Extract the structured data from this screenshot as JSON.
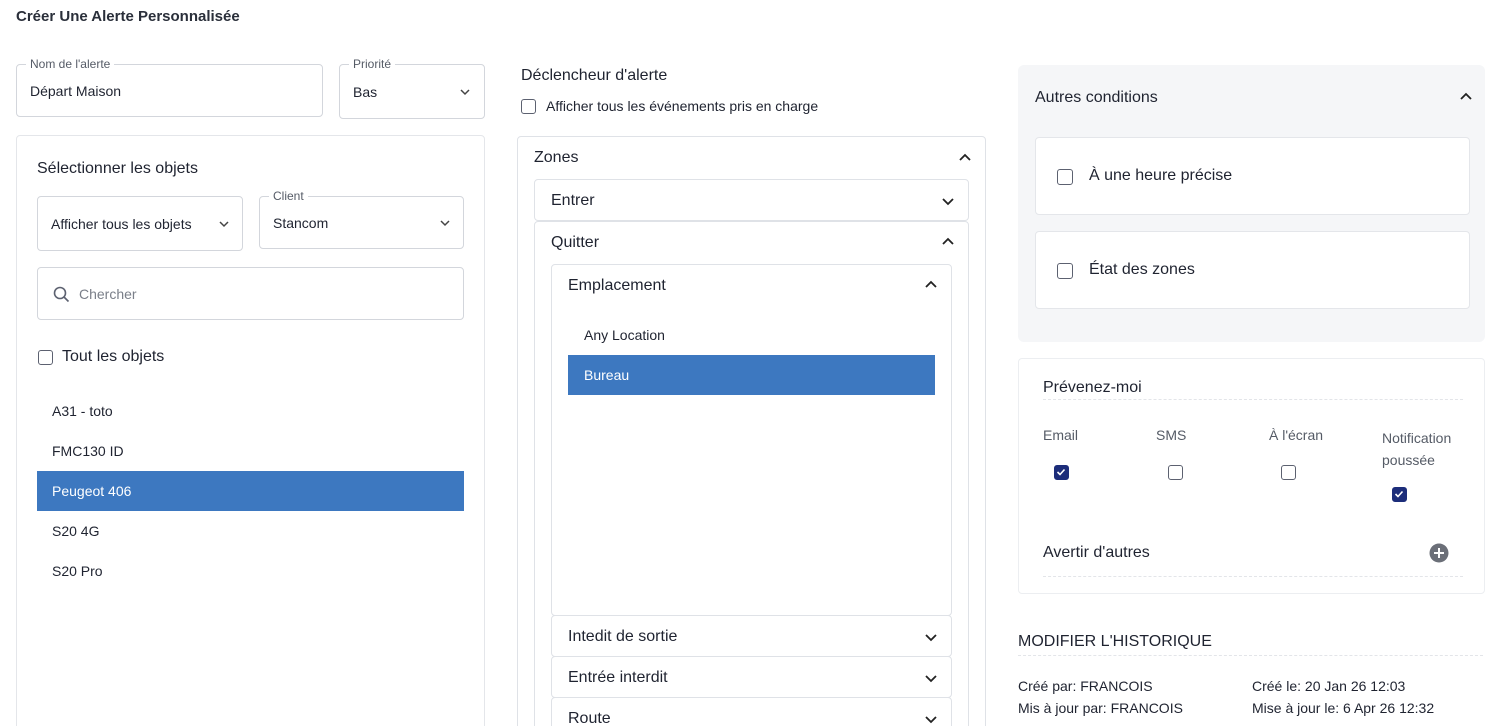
{
  "page": {
    "title": "Créer Une Alerte Personnalisée"
  },
  "alert_name": {
    "label": "Nom de l'alerte",
    "value": "Départ Maison"
  },
  "priority": {
    "label": "Priorité",
    "value": "Bas"
  },
  "objects_panel": {
    "title": "Sélectionner les objets",
    "filter_value": "Afficher tous les objets",
    "client_label": "Client",
    "client_value": "Stancom",
    "search_placeholder": "Chercher",
    "all_objects_label": "Tout les objets",
    "items": [
      {
        "label": "A31 - toto",
        "selected": false
      },
      {
        "label": "FMC130 ID",
        "selected": false
      },
      {
        "label": "Peugeot 406",
        "selected": true
      },
      {
        "label": "S20 4G",
        "selected": false
      },
      {
        "label": "S20 Pro",
        "selected": false
      }
    ]
  },
  "trigger": {
    "title": "Déclencheur d'alerte",
    "show_all_label": "Afficher tous les événements pris en charge",
    "zones_label": "Zones",
    "enter_label": "Entrer",
    "leave_label": "Quitter",
    "location_label": "Emplacement",
    "locations": [
      {
        "label": "Any Location",
        "selected": false
      },
      {
        "label": "Bureau",
        "selected": true
      }
    ],
    "exit_forbidden_label": "Intedit de sortie",
    "entry_forbidden_label": "Entrée interdit",
    "route_label": "Route"
  },
  "other_conditions": {
    "title": "Autres conditions",
    "specific_time_label": "À une heure précise",
    "zone_state_label": "État des zones"
  },
  "notify": {
    "title": "Prévenez-moi",
    "channels": [
      {
        "label": "Email",
        "checked": true
      },
      {
        "label": "SMS",
        "checked": false
      },
      {
        "label": "À l'écran",
        "checked": false
      },
      {
        "label": "Notification poussée",
        "checked": true
      }
    ],
    "notify_others_label": "Avertir d'autres"
  },
  "history": {
    "title": "MODIFIER L'HISTORIQUE",
    "created_by": "Créé par: FRANCOIS",
    "created_on": "Créé le: 20 Jan 26 12:03",
    "updated_by": "Mis à jour par: FRANCOIS",
    "updated_on": "Mise à jour le: 6 Apr 26 12:32"
  },
  "colors": {
    "accent_blue": "#3d78c0",
    "checkbox_navy": "#1c2d7a"
  }
}
